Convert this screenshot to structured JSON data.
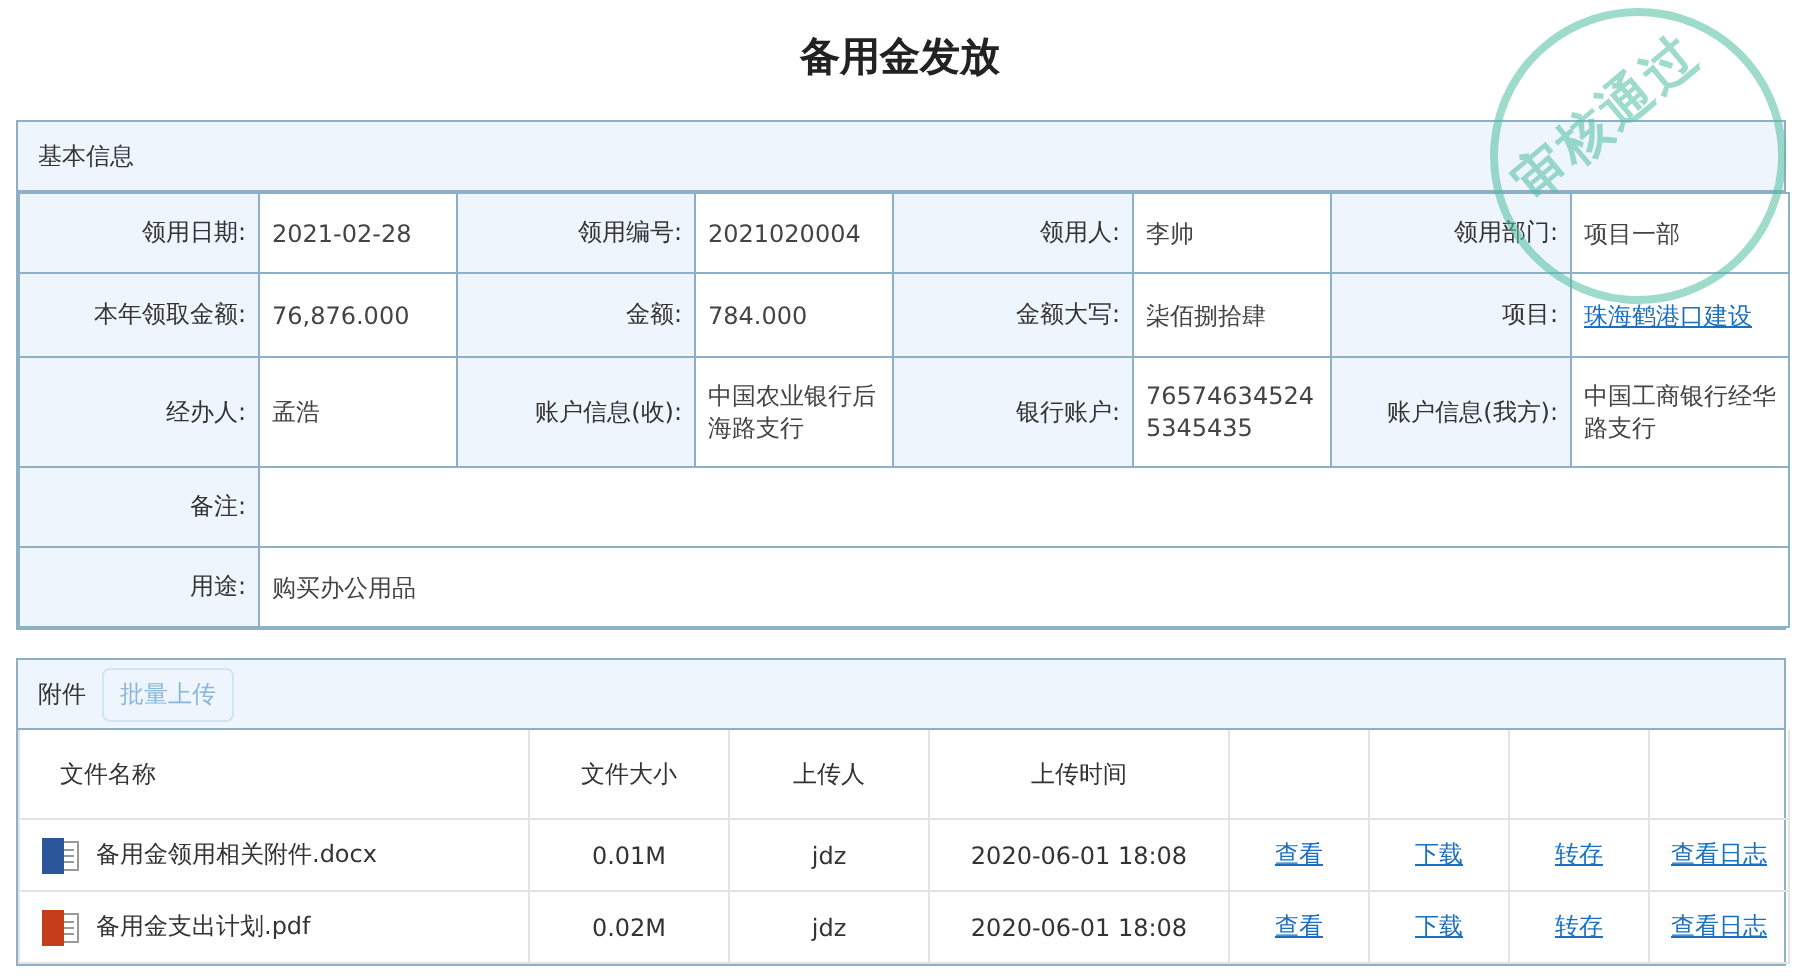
{
  "title": "备用金发放",
  "stamp": {
    "text": "审核通过"
  },
  "info": {
    "heading": "基本信息",
    "rows": [
      [
        {
          "label": "领用日期:",
          "value": "2021-02-28",
          "kind": "text"
        },
        {
          "label": "领用编号:",
          "value": "2021020004",
          "kind": "text"
        },
        {
          "label": "领用人:",
          "value": "李帅",
          "kind": "text"
        },
        {
          "label": "领用部门:",
          "value": "项目一部",
          "kind": "text"
        }
      ],
      [
        {
          "label": "本年领取金额:",
          "value": "76,876.000",
          "kind": "text"
        },
        {
          "label": "金额:",
          "value": "784.000",
          "kind": "text"
        },
        {
          "label": "金额大写:",
          "value": "柒佰捌拾肆",
          "kind": "text"
        },
        {
          "label": "项目:",
          "value": "珠海鹤港口建设",
          "kind": "link"
        }
      ],
      [
        {
          "label": "经办人:",
          "value": "孟浩",
          "kind": "text"
        },
        {
          "label": "账户信息(收):",
          "value": "中国农业银行后海路支行",
          "kind": "text"
        },
        {
          "label": "银行账户:",
          "value": "765746345245345435",
          "kind": "text"
        },
        {
          "label": "账户信息(我方):",
          "value": "中国工商银行经华路支行",
          "kind": "text"
        }
      ],
      [
        {
          "label": "备注:"
        }
      ],
      [
        {
          "label": "用途:",
          "value": "购买办公用品",
          "kind": "text"
        }
      ]
    ]
  },
  "attachments": {
    "heading": "附件",
    "upload_button": "批量上传",
    "columns": [
      "文件名称",
      "文件大小",
      "上传人",
      "上传时间"
    ],
    "rows": [
      {
        "name": "备用金领用相关附件.docx",
        "kind": "word",
        "size": "0.01M",
        "uploader": "jdz",
        "time": "2020-06-01 18:08",
        "actions": [
          "查看",
          "下载",
          "转存",
          "查看日志"
        ]
      },
      {
        "name": "备用金支出计划.pdf",
        "kind": "pdf",
        "size": "0.02M",
        "uploader": "jdz",
        "time": "2020-06-01 18:08",
        "actions": [
          "查看",
          "下载",
          "转存",
          "查看日志"
        ]
      }
    ]
  }
}
